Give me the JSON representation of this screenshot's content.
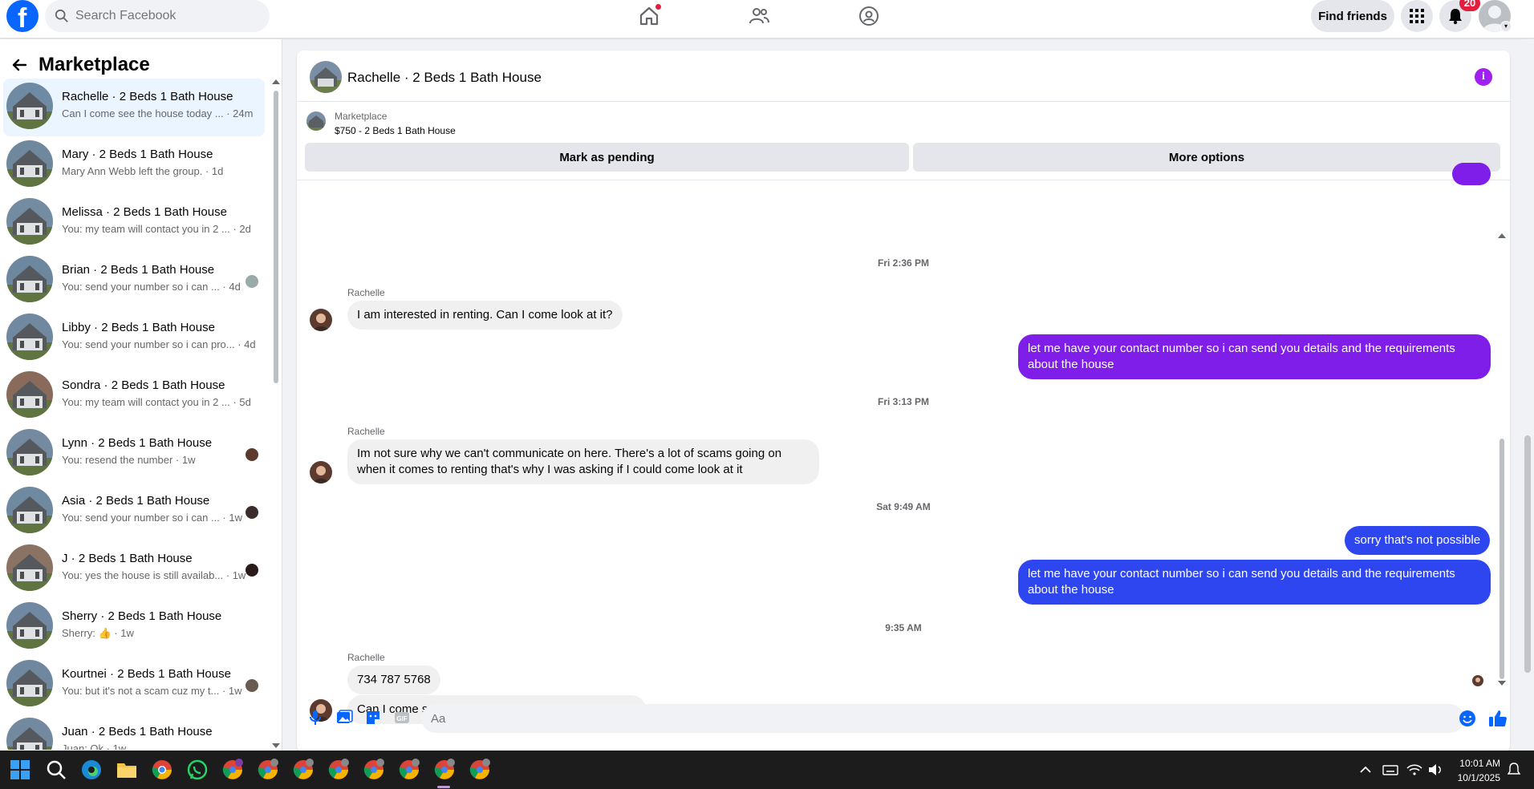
{
  "topbar": {
    "search_placeholder": "Search Facebook",
    "find_friends_label": "Find friends",
    "notification_count": "20"
  },
  "sidebar": {
    "title": "Marketplace",
    "conversations": [
      {
        "name": "Rachelle · 2 Beds 1 Bath House",
        "preview": "Can I come see the house today ... · 24m",
        "active": true
      },
      {
        "name": "Mary · 2 Beds 1 Bath House",
        "preview": "Mary Ann Webb left the group. · 1d"
      },
      {
        "name": "Melissa · 2 Beds 1 Bath House",
        "preview": "You: my team will contact you in 2 ... · 2d"
      },
      {
        "name": "Brian · 2 Beds 1 Bath House",
        "preview": "You: send your number so i can ... · 4d"
      },
      {
        "name": "Libby · 2 Beds 1 Bath House",
        "preview": "You: send your number so i can pro... · 4d"
      },
      {
        "name": "Sondra · 2 Beds 1 Bath House",
        "preview": "You: my team will contact you in 2 ... · 5d"
      },
      {
        "name": "Lynn · 2 Beds 1 Bath House",
        "preview": "You: resend the number · 1w"
      },
      {
        "name": "Asia · 2 Beds 1 Bath House",
        "preview": "You: send your number so i can ... · 1w"
      },
      {
        "name": "J · 2 Beds 1 Bath House",
        "preview": "You: yes the house is still availab... · 1w"
      },
      {
        "name": "Sherry · 2 Beds 1 Bath House",
        "preview": "Sherry: 👍 · 1w"
      },
      {
        "name": "Kourtnei · 2 Beds 1 Bath House",
        "preview": "You: but it's not a scam cuz my t... · 1w"
      },
      {
        "name": "Juan · 2 Beds 1 Bath House",
        "preview": "Juan: Ok · 1w"
      }
    ]
  },
  "chat": {
    "title": "Rachelle · 2 Beds 1 Bath House",
    "listing_source": "Marketplace",
    "listing_title": "$750 - 2 Beds 1 Bath House",
    "mark_pending_label": "Mark as pending",
    "more_options_label": "More options",
    "timestamps": [
      "Fri 2:36 PM",
      "Fri 3:13 PM",
      "Sat 9:49 AM",
      "9:35 AM"
    ],
    "sender_name": "Rachelle",
    "messages": {
      "m1": "I am interested in renting. Can I come look at it?",
      "m2": "let me have your contact number so i can send you details and the requirements about the house",
      "m3": "Im not sure why we can't communicate on here. There's a lot of scams going on when it comes to renting that's why I was asking if I could come look at it",
      "m4": "sorry that's not possible",
      "m5": "let me have your contact number so i can send you details and the requirements about the house",
      "m6": "734 787 5768",
      "m7": "Can I come see the house today after I get off work?"
    },
    "composer_placeholder": "Aa"
  },
  "taskbar": {
    "time": "10:01 AM",
    "date": "10/1/2025"
  },
  "colors": {
    "brand": "#0866ff",
    "outgoing_purple": "#7f1ee8",
    "outgoing_blue": "#2e46f0",
    "info_icon": "#a020f0"
  }
}
